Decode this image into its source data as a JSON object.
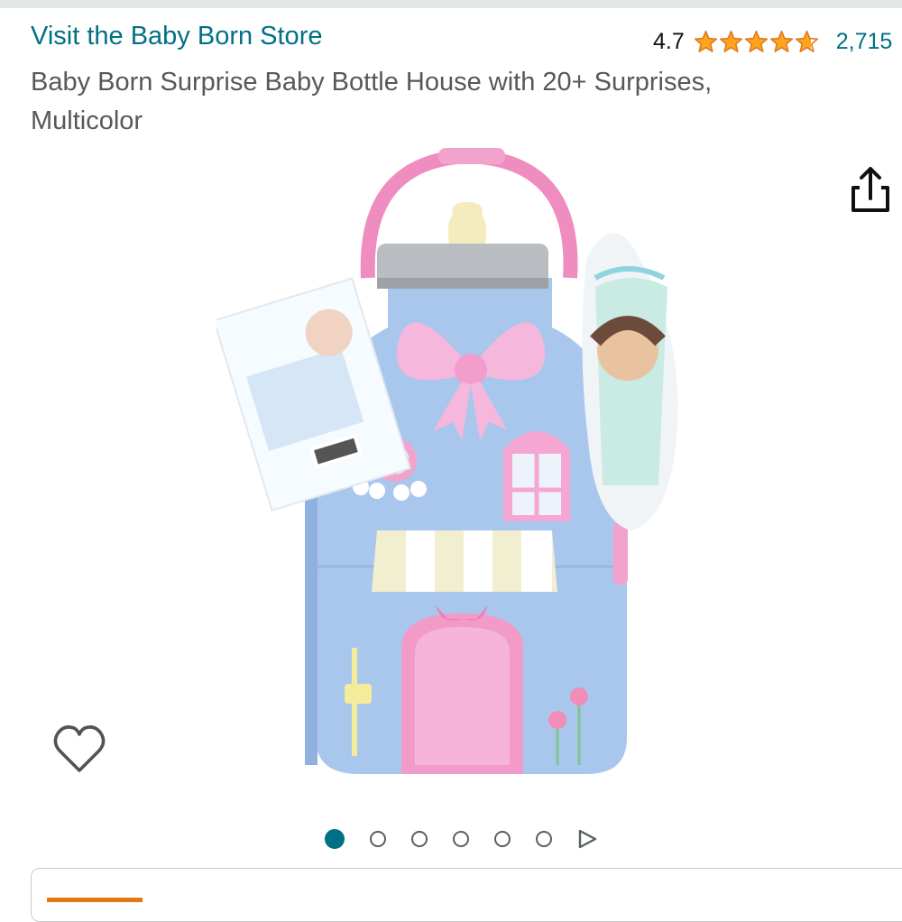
{
  "header": {
    "store_link": "Visit the Baby Born Store",
    "rating_value": "4.7",
    "rating_stars": 4.7,
    "rating_count": "2,715",
    "star_color": "#ffa41c"
  },
  "product": {
    "title": "Baby Born Surprise Baby Bottle House with 20+ Surprises, Multicolor",
    "image_label": "Baby Born Surprise Baby Bottle House product photo"
  },
  "gallery": {
    "image_count": 6,
    "active_index": 0,
    "accent_color": "#007185"
  },
  "icons": {
    "share": "share-icon",
    "wishlist": "heart-outline-icon",
    "next": "play-triangle-icon"
  }
}
